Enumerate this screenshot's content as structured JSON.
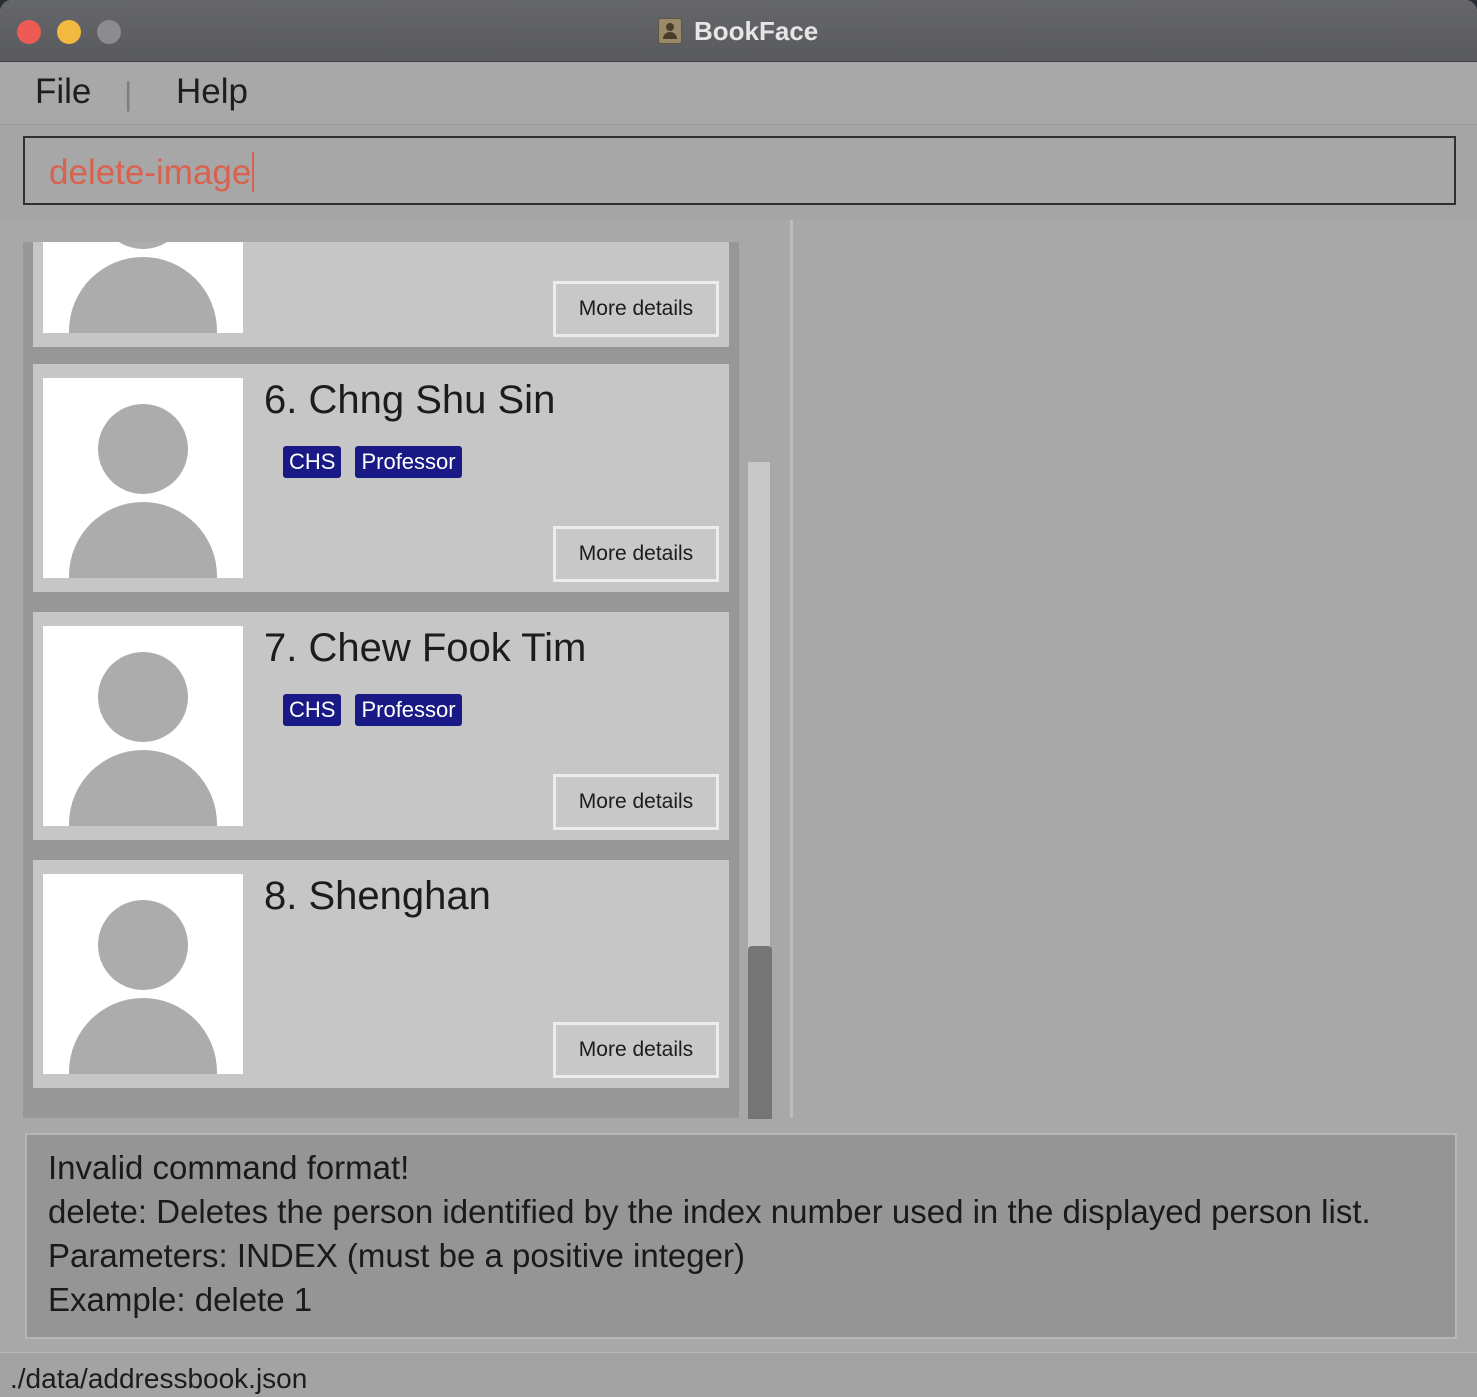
{
  "window": {
    "title": "BookFace"
  },
  "menu": {
    "file": "File",
    "separator": "|",
    "help": "Help"
  },
  "command": {
    "value": "delete-image"
  },
  "persons": [
    {
      "more_label": "More details"
    },
    {
      "name": "6. Chng Shu Sin",
      "tags": [
        "CHS",
        "Professor"
      ],
      "more_label": "More details"
    },
    {
      "name": "7. Chew Fook Tim",
      "tags": [
        "CHS",
        "Professor"
      ],
      "more_label": "More details"
    },
    {
      "name": "8. Shenghan",
      "tags": [],
      "more_label": "More details"
    }
  ],
  "result": {
    "lines": [
      "Invalid command format!",
      "delete: Deletes the person identified by the index number used in the displayed person list.",
      "Parameters: INDEX (must be a positive integer)",
      "Example: delete 1"
    ]
  },
  "status": {
    "path": "./data/addressbook.json"
  },
  "colors": {
    "tag_bg": "#1a1a86",
    "command_text": "#d9624f"
  }
}
